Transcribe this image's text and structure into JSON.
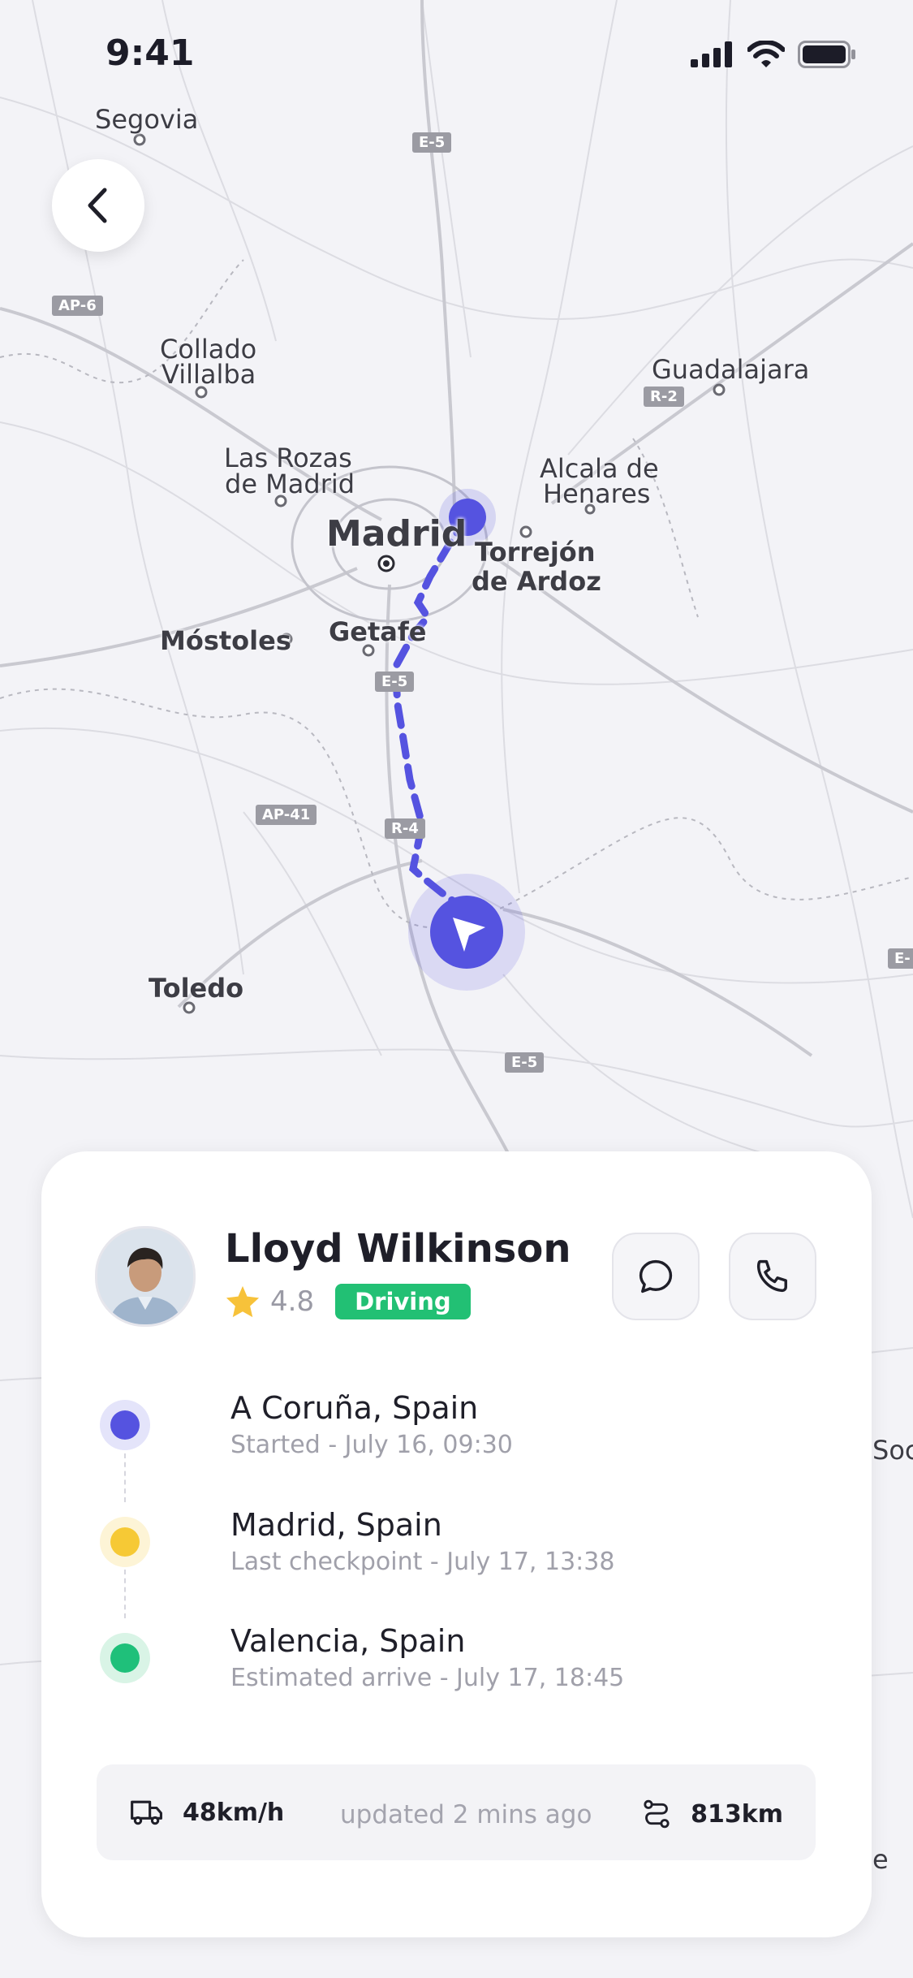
{
  "status_bar": {
    "time": "9:41"
  },
  "map": {
    "labels": {
      "segovia": "Segovia",
      "collado": "Collado",
      "villalba": "Villalba",
      "las_rozas": "Las Rozas",
      "de_madrid": "de Madrid",
      "madrid": "Madrid",
      "torrejon": "Torrejón",
      "de_ardoz": "de Ardoz",
      "alcala": "Alcala de",
      "henares": "Henares",
      "guadalajara": "Guadalajara",
      "mostoles": "Móstoles",
      "getafe": "Getafe",
      "toledo": "Toledo",
      "soc": "Soc",
      "edge_e": "e"
    },
    "roads": {
      "e5_top": "E-5",
      "ap6": "AP-6",
      "r2": "R-2",
      "e5_mid": "E-5",
      "ap41": "AP-41",
      "r4": "R-4",
      "e5_bottom": "E-5",
      "e_right": "E-"
    },
    "route_color": "#5553e0"
  },
  "driver": {
    "name": "Lloyd Wilkinson",
    "rating": "4.8",
    "status": "Driving"
  },
  "stops": [
    {
      "city": "A Coruña, Spain",
      "detail": "Started - July 16, 09:30",
      "color": "#5553e0"
    },
    {
      "city": "Madrid, Spain",
      "detail": "Last checkpoint - July 17, 13:38",
      "color": "#f6c935"
    },
    {
      "city": "Valencia, Spain",
      "detail": "Estimated arrive - July 17, 18:45",
      "color": "#1fc07a"
    }
  ],
  "trip": {
    "speed": "48km/h",
    "updated": "updated 2 mins ago",
    "distance": "813km"
  },
  "icons": {
    "back": "chevron-left-icon",
    "message": "chat-bubble-icon",
    "call": "phone-icon",
    "speed": "truck-icon",
    "distance": "route-icon",
    "rating": "star-icon"
  }
}
